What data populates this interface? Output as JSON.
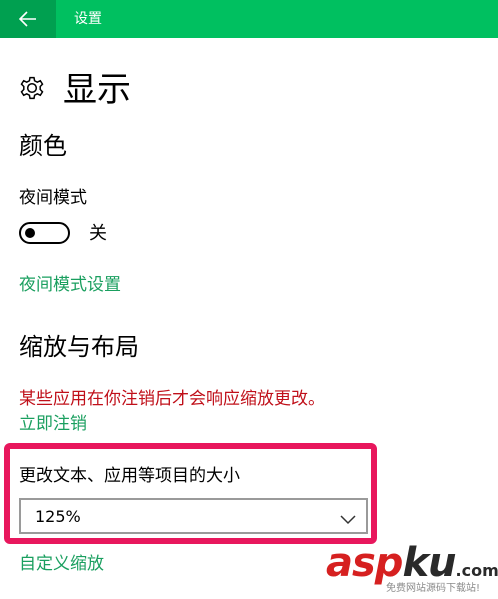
{
  "window": {
    "title": "设置",
    "back_icon": "arrow-left-icon",
    "titlebar_color": "#00c060",
    "back_button_color": "#00a050"
  },
  "page": {
    "title": "显示",
    "icon": "gear-icon"
  },
  "color_section": {
    "title": "颜色",
    "night_mode_label": "夜间模式",
    "night_mode_state": "关",
    "night_mode_on": false,
    "night_mode_settings_link": "夜间模式设置"
  },
  "scale_section": {
    "title": "缩放与布局",
    "warning": "某些应用在你注销后才会响应缩放更改。",
    "sign_out_link": "立即注销",
    "size_label": "更改文本、应用等项目的大小",
    "size_value": "125%",
    "custom_scaling_link": "自定义缩放"
  },
  "colors": {
    "accent_link": "#1a9f5f",
    "warning": "#c0101a",
    "highlight_border": "#e8175d"
  },
  "watermark": {
    "logo_asp": "asp",
    "logo_ku": "ku",
    "logo_com": ".com",
    "tagline": "免费网站源码下载站!"
  }
}
